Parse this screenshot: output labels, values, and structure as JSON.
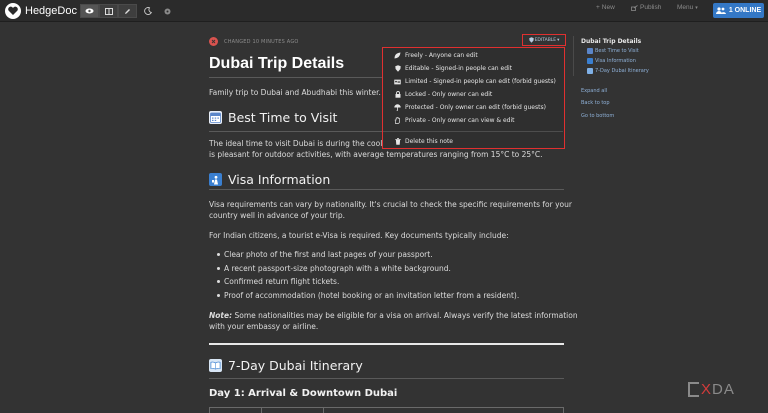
{
  "navbar": {
    "brand": "HedgeDoc",
    "new_label": "New",
    "publish_label": "Publish",
    "menu_label": "Menu",
    "online_label": "1 ONLINE"
  },
  "status": {
    "changed_text": "CHANGED 10 MINUTES AGO"
  },
  "permission": {
    "button_label": "EDITABLE",
    "items": [
      {
        "icon": "leaf-icon",
        "label": "Freely - Anyone can edit"
      },
      {
        "icon": "shield-icon",
        "label": "Editable - Signed-in people can edit"
      },
      {
        "icon": "id-card-icon",
        "label": "Limited - Signed-in people can edit (forbid guests)"
      },
      {
        "icon": "lock-icon",
        "label": "Locked - Only owner can edit"
      },
      {
        "icon": "umbrella-icon",
        "label": "Protected - Only owner can edit (forbid guests)"
      },
      {
        "icon": "hand-icon",
        "label": "Private - Only owner can view & edit"
      }
    ],
    "delete_label": "Delete this note"
  },
  "document": {
    "title": "Dubai Trip Details",
    "intro": "Family trip to Dubai and Abudhabi this winter.",
    "h_best_time": "Best Time to Visit",
    "best_time_line1": "The ideal time to visit Dubai is during the cooler",
    "best_time_line2": "is pleasant for outdoor activities, with average temperatures ranging from 15°C to 25°C.",
    "h_visa": "Visa Information",
    "visa_p1_line1": "Visa requirements can vary by nationality. It's crucial to check the specific requirements for your",
    "visa_p1_line2": "country well in advance of your trip.",
    "visa_p2": "For Indian citizens, a tourist e-Visa is required. Key documents typically include:",
    "bullets": [
      "Clear photo of the first and last pages of your passport.",
      "A recent passport-size photograph with a white background.",
      "Confirmed return flight tickets.",
      "Proof of accommodation (hotel booking or an invitation letter from a resident)."
    ],
    "note_label": "Note:",
    "note_line1": " Some nationalities may be eligible for a visa on arrival. Always verify the latest information",
    "note_line2": "with your embassy or airline.",
    "h_itinerary": "7-Day Dubai Itinerary",
    "h_day1": "Day 1: Arrival & Downtown Dubai"
  },
  "toc": {
    "title": "Dubai Trip Details",
    "items": [
      "Best Time to Visit",
      "Visa Information",
      "7-Day Dubai Itinerary"
    ],
    "expand_all": "Expand all",
    "back_to_top": "Back to top",
    "go_to_bottom": "Go to bottom"
  },
  "watermark": {
    "x": "X",
    "rest": "DA"
  },
  "colors": {
    "accent": "#3478c6",
    "highlight": "#e03030",
    "link": "#8fb1d8"
  }
}
